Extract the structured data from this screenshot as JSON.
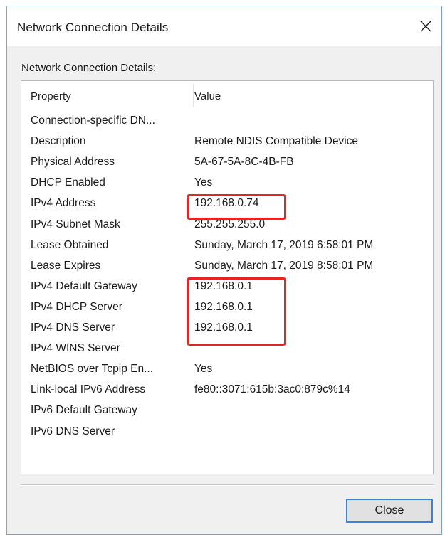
{
  "window": {
    "title": "Network Connection Details",
    "close_glyph": "✕",
    "close_icon": "close-icon"
  },
  "group_label": "Network Connection Details:",
  "table": {
    "columns": [
      "Property",
      "Value"
    ],
    "rows": [
      {
        "property": "Connection-specific DN...",
        "value": ""
      },
      {
        "property": "Description",
        "value": "Remote NDIS Compatible Device"
      },
      {
        "property": "Physical Address",
        "value": "5A-67-5A-8C-4B-FB"
      },
      {
        "property": "DHCP Enabled",
        "value": "Yes"
      },
      {
        "property": "IPv4 Address",
        "value": "192.168.0.74"
      },
      {
        "property": "IPv4 Subnet Mask",
        "value": "255.255.255.0"
      },
      {
        "property": "Lease Obtained",
        "value": "Sunday, March 17, 2019 6:58:01 PM"
      },
      {
        "property": "Lease Expires",
        "value": "Sunday, March 17, 2019 8:58:01 PM"
      },
      {
        "property": "IPv4 Default Gateway",
        "value": "192.168.0.1"
      },
      {
        "property": "IPv4 DHCP Server",
        "value": "192.168.0.1"
      },
      {
        "property": "IPv4 DNS Server",
        "value": "192.168.0.1"
      },
      {
        "property": "IPv4 WINS Server",
        "value": ""
      },
      {
        "property": "NetBIOS over Tcpip En...",
        "value": "Yes"
      },
      {
        "property": "Link-local IPv6 Address",
        "value": "fe80::3071:615b:3ac0:879c%14"
      },
      {
        "property": "IPv6 Default Gateway",
        "value": ""
      },
      {
        "property": "IPv6 DNS Server",
        "value": ""
      }
    ]
  },
  "highlight_color": "#e32525",
  "buttons": {
    "close_label": "Close"
  }
}
